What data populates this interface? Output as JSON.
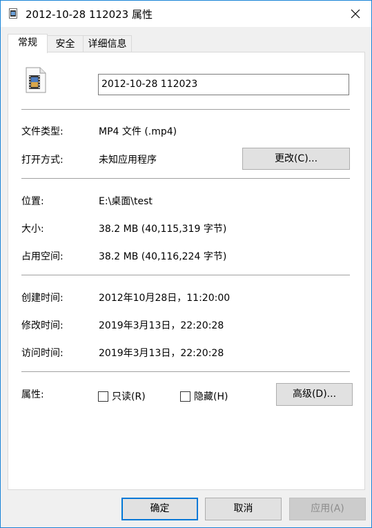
{
  "window": {
    "title": "2012-10-28 112023 属性"
  },
  "tabs": [
    {
      "label": "常规"
    },
    {
      "label": "安全"
    },
    {
      "label": "详细信息"
    }
  ],
  "general": {
    "file_name": "2012-10-28 112023",
    "file_type_label": "文件类型:",
    "file_type_value": "MP4 文件 (.mp4)",
    "open_with_label": "打开方式:",
    "open_with_value": "未知应用程序",
    "change_button": "更改(C)...",
    "location_label": "位置:",
    "location_value": "E:\\桌面\\test",
    "size_label": "大小:",
    "size_value": "38.2 MB (40,115,319 字节)",
    "size_on_disk_label": "占用空间:",
    "size_on_disk_value": "38.2 MB (40,116,224 字节)",
    "created_label": "创建时间:",
    "created_value": "2012年10月28日，11:20:00",
    "modified_label": "修改时间:",
    "modified_value": "2019年3月13日，22:20:28",
    "accessed_label": "访问时间:",
    "accessed_value": "2019年3月13日，22:20:28",
    "attributes_label": "属性:",
    "readonly_label": "只读(R)",
    "hidden_label": "隐藏(H)",
    "advanced_button": "高级(D)..."
  },
  "footer": {
    "ok": "确定",
    "cancel": "取消",
    "apply": "应用(A)"
  },
  "colors": {
    "accent": "#0078d7",
    "border": "#1883d7"
  }
}
